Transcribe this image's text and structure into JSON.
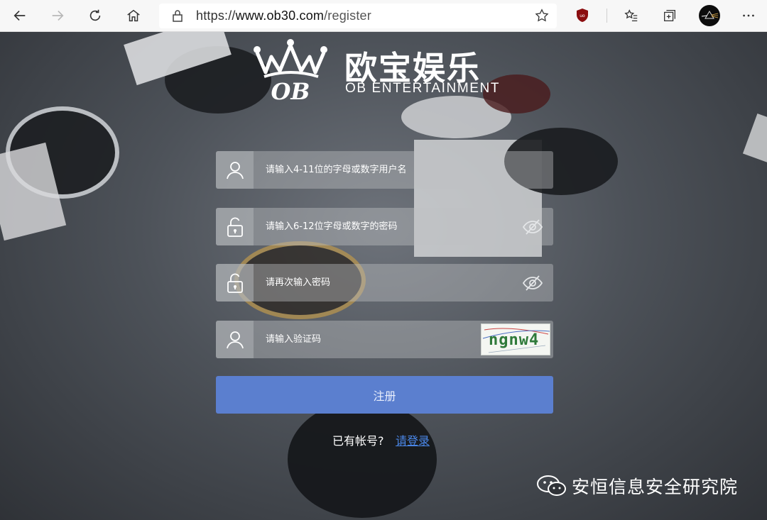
{
  "browser": {
    "url_prefix": "https://",
    "url_host": "www.ob30.com",
    "url_path": "/register",
    "icons": [
      "back-icon",
      "forward-icon",
      "refresh-icon",
      "home-icon",
      "lock-icon",
      "favorite-star-icon",
      "ublock-icon",
      "favorites-icon",
      "collections-icon",
      "profile-avatar",
      "more-icon"
    ]
  },
  "logo": {
    "crown_text": "OB",
    "title": "欧宝娱乐",
    "subtitle": "OB ENTERTAINMENT"
  },
  "form": {
    "username_placeholder": "请输入4-11位的字母或数字用户名",
    "password_placeholder": "请输入6-12位字母或数字的密码",
    "confirm_placeholder": "请再次输入密码",
    "captcha_placeholder": "请输入验证码",
    "captcha_image_text": "ngnw4",
    "submit_label": "注册",
    "have_account": "已有帐号?",
    "login_link": "请登录"
  },
  "watermark": {
    "text": "安恒信息安全研究院"
  },
  "colors": {
    "submit": "#5b7fcf",
    "link": "#4a87e8",
    "captcha_text": "#2f7a3a"
  }
}
